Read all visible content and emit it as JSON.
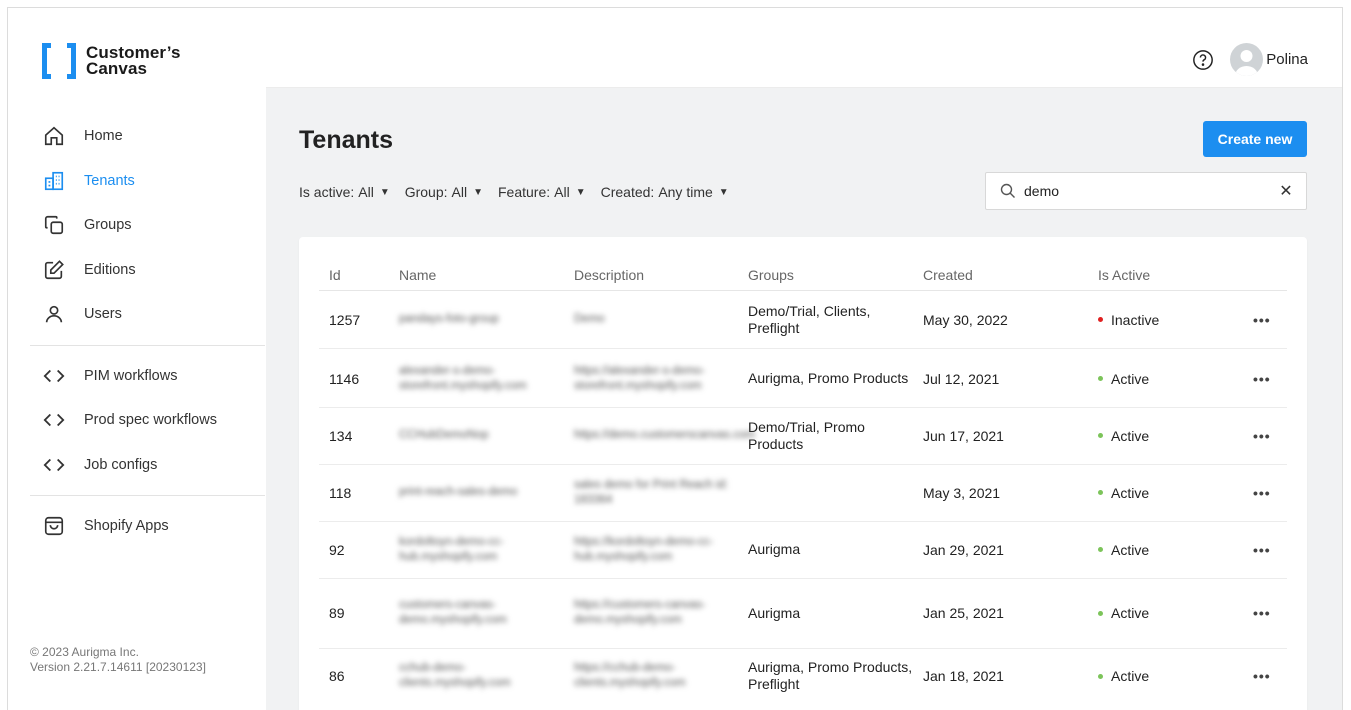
{
  "brand": {
    "line1": "Customer’s",
    "line2": "Canvas",
    "color": "#1c8ef0"
  },
  "sidebar": {
    "items": [
      {
        "label": "Home",
        "icon": "home-icon"
      },
      {
        "label": "Tenants",
        "icon": "building-icon",
        "active": true
      },
      {
        "label": "Groups",
        "icon": "groups-icon"
      },
      {
        "label": "Editions",
        "icon": "edit-icon"
      },
      {
        "label": "Users",
        "icon": "user-icon"
      },
      {
        "label": "PIM workflows",
        "icon": "code-icon"
      },
      {
        "label": "Prod spec workflows",
        "icon": "code-icon"
      },
      {
        "label": "Job configs",
        "icon": "code-icon"
      },
      {
        "label": "Shopify Apps",
        "icon": "shopify-bag-icon"
      }
    ],
    "footer": {
      "copyright": "© 2023 Aurigma Inc.",
      "version": "Version 2.21.7.14611 [20230123]"
    }
  },
  "header": {
    "user_name": "Polina",
    "help_icon": "help-icon"
  },
  "page": {
    "title": "Tenants",
    "create_label": "Create new",
    "filters": [
      {
        "label": "Is active:",
        "value": "All"
      },
      {
        "label": "Group:",
        "value": "All"
      },
      {
        "label": "Feature:",
        "value": "All"
      },
      {
        "label": "Created:",
        "value": "Any time"
      }
    ],
    "search": {
      "value": "demo",
      "clear": "✕"
    }
  },
  "table": {
    "columns": [
      "Id",
      "Name",
      "Description",
      "Groups",
      "Created",
      "Is Active"
    ],
    "rows": [
      {
        "id": "1257",
        "name": "pandays-foto-group",
        "desc": "Demo",
        "groups": "Demo/Trial, Clients, Preflight",
        "created": "May 30, 2022",
        "status": "Inactive",
        "status_color": "#e02020",
        "more": "•••"
      },
      {
        "id": "1146",
        "name": "alexander-s-demo-storefront.myshopify.com",
        "desc": "https://alexander-s-demo-storefront.myshopify.com",
        "groups": "Aurigma, Promo Products",
        "created": "Jul 12, 2021",
        "status": "Active",
        "status_color": "#7cc45a",
        "more": "•••"
      },
      {
        "id": "134",
        "name": "CCHubDemoNop",
        "desc": "https://demo.customerscanvas.com",
        "groups": "Demo/Trial, Promo Products",
        "created": "Jun 17, 2021",
        "status": "Active",
        "status_color": "#7cc45a",
        "more": "•••"
      },
      {
        "id": "118",
        "name": "print-reach-sales-demo",
        "desc": "sales demo for Print Reach id: 183364",
        "groups": "",
        "created": "May 3, 2021",
        "status": "Active",
        "status_color": "#7cc45a",
        "more": "•••"
      },
      {
        "id": "92",
        "name": "kordoltoyn-demo-cc-hub.myshopify.com",
        "desc": "https://kordoltoyn-demo-cc-hub.myshopify.com",
        "groups": "Aurigma",
        "created": "Jan 29, 2021",
        "status": "Active",
        "status_color": "#7cc45a",
        "more": "•••"
      },
      {
        "id": "89",
        "name": "customers-canvas-demo.myshopify.com",
        "desc": "https://customers-canvas-demo.myshopify.com",
        "groups": "Aurigma",
        "created": "Jan 25, 2021",
        "status": "Active",
        "status_color": "#7cc45a",
        "more": "•••"
      },
      {
        "id": "86",
        "name": "cchub-demo-clients.myshopify.com",
        "desc": "https://cchub-demo-clients.myshopify.com",
        "groups": "Aurigma, Promo Products, Preflight",
        "created": "Jan 18, 2021",
        "status": "Active",
        "status_color": "#7cc45a",
        "more": "•••"
      }
    ]
  }
}
